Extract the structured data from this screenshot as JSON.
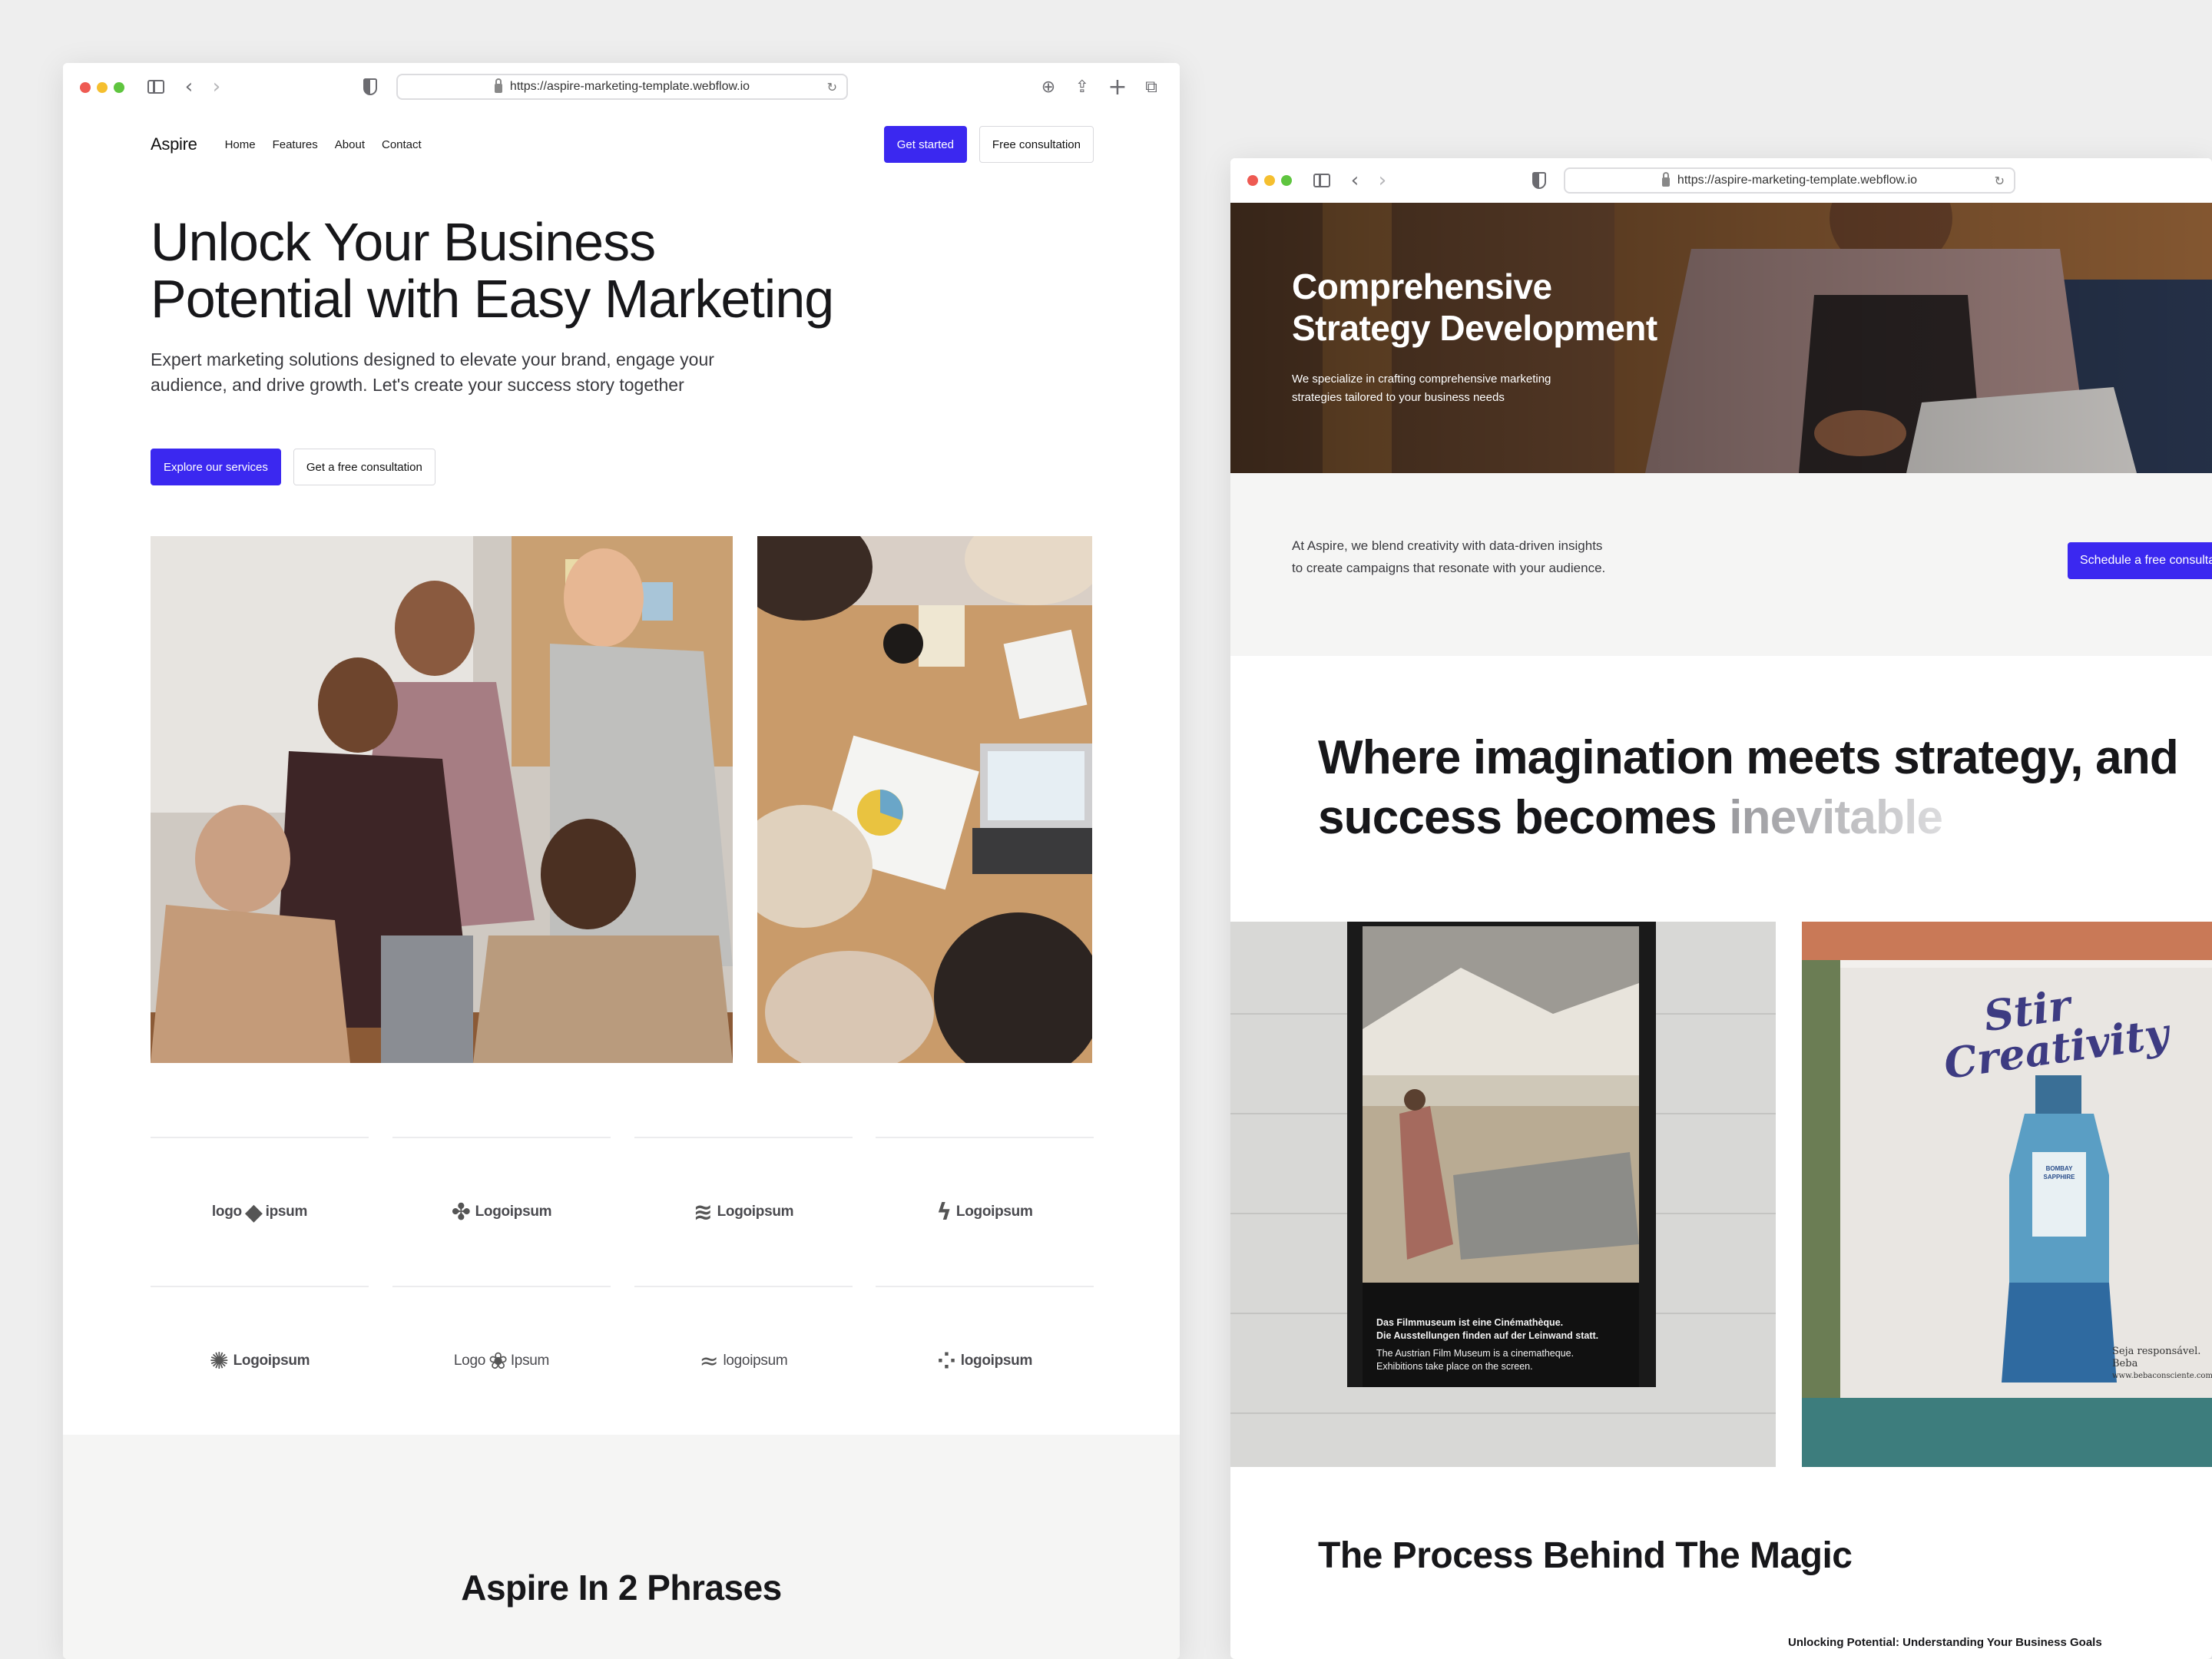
{
  "left": {
    "url": "https://aspire-marketing-template.webflow.io",
    "nav": {
      "logo": "Aspire",
      "links": [
        "Home",
        "Features",
        "About",
        "Contact"
      ],
      "get_started": "Get started",
      "consultation": "Free consultation"
    },
    "hero": {
      "title_line1": "Unlock Your Business",
      "title_line2": "Potential with Easy Marketing",
      "subtitle_line1": "Expert marketing solutions designed to elevate your brand, engage your",
      "subtitle_line2": "audience, and drive growth. Let's create your success story together",
      "cta_primary": "Explore our services",
      "cta_secondary": "Get a free consultation"
    },
    "logos": [
      {
        "text": "logo",
        "text2": "ipsum",
        "icon": "bear-logo-icon"
      },
      {
        "text": "Logoipsum",
        "text2": "",
        "icon": "circle-logo-icon"
      },
      {
        "text": "Logoipsum",
        "text2": "",
        "icon": "wave-logo-icon"
      },
      {
        "text": "Logoipsum",
        "text2": "",
        "icon": "bolt-logo-icon"
      },
      {
        "text": "Logoipsum",
        "text2": "",
        "icon": "burst-logo-icon"
      },
      {
        "text": "Logo",
        "text2": "Ipsum",
        "icon": "flower-logo-icon"
      },
      {
        "text": "logoipsum",
        "text2": "",
        "icon": "waves-logo-icon"
      },
      {
        "text": "logoipsum",
        "text2": "",
        "icon": "dots-logo-icon"
      }
    ],
    "phrases_title": "Aspire In 2 Phrases"
  },
  "right": {
    "url": "https://aspire-marketing-template.webflow.io",
    "hero": {
      "title_line1": "Comprehensive",
      "title_line2": "Strategy Development",
      "subtitle_line1": "We specialize in crafting comprehensive marketing",
      "subtitle_line2": "strategies tailored to your business needs"
    },
    "band": {
      "text_line1": "At Aspire, we blend creativity with data-driven insights",
      "text_line2": "to create campaigns that resonate with your audience.",
      "button": "Schedule a free consulta"
    },
    "imagination": {
      "line1": "Where imagination meets strategy, and",
      "line2_solid": "success becomes ",
      "line2_fade": "inevitable"
    },
    "poster": {
      "line1": "Das Filmmuseum ist eine Cinémathèque.",
      "line2": "Die Ausstellungen finden auf der Leinwand statt.",
      "line3": "The Austrian Film Museum is a cinematheque.",
      "line4": "Exhibitions take place on the screen."
    },
    "billboard": {
      "script1": "Stir",
      "script2": "Creativity",
      "bottle1": "BOMBAY",
      "bottle2": "SAPPHIRE",
      "tagline1": "Seja responsável. Beba",
      "tagline2": "www.bebaconsciente.com"
    },
    "process_title": "The Process Behind The Magic",
    "process_sub": "Unlocking Potential: Understanding Your Business Goals"
  }
}
